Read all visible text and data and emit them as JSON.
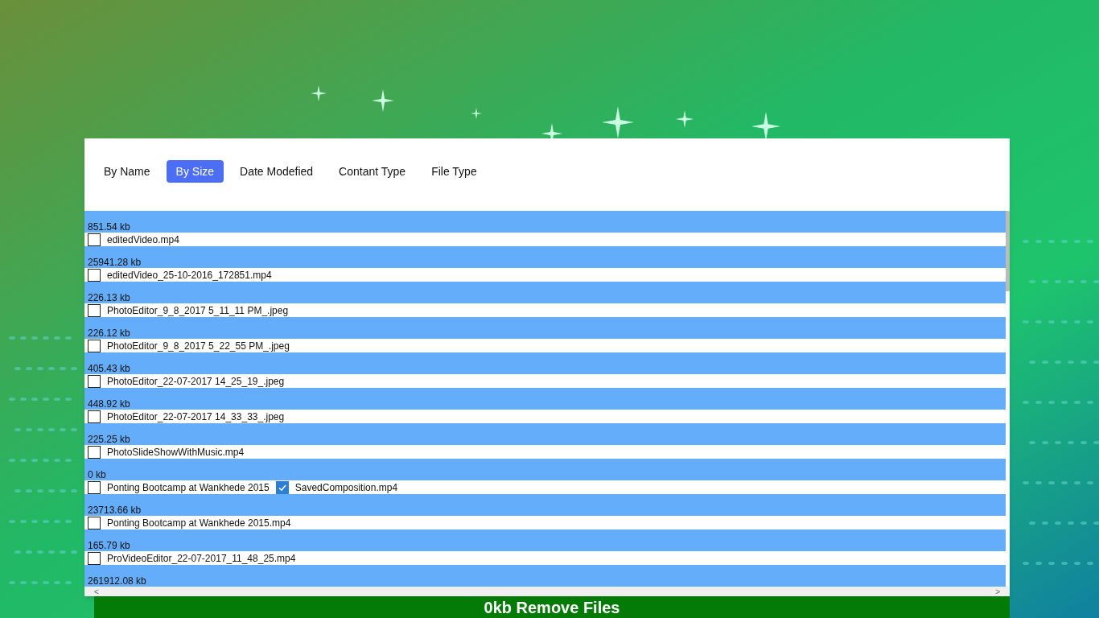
{
  "tabs": [
    {
      "label": "By Name",
      "selected": false
    },
    {
      "label": "By Size",
      "selected": true
    },
    {
      "label": "Date Modefied",
      "selected": false
    },
    {
      "label": "Contant Type",
      "selected": false
    },
    {
      "label": "File Type",
      "selected": false
    }
  ],
  "entries": [
    {
      "size": "851.54 kb",
      "files": [
        {
          "name": "editedVideo.mp4",
          "checked": false
        }
      ]
    },
    {
      "size": "25941.28 kb",
      "files": [
        {
          "name": "editedVideo_25-10-2016_172851.mp4",
          "checked": false
        }
      ]
    },
    {
      "size": "226.13 kb",
      "files": [
        {
          "name": "PhotoEditor_9_8_2017 5_11_11 PM_.jpeg",
          "checked": false
        }
      ]
    },
    {
      "size": "226.12 kb",
      "files": [
        {
          "name": "PhotoEditor_9_8_2017 5_22_55 PM_.jpeg",
          "checked": false
        }
      ]
    },
    {
      "size": "405.43 kb",
      "files": [
        {
          "name": "PhotoEditor_22-07-2017 14_25_19_.jpeg",
          "checked": false
        }
      ]
    },
    {
      "size": "448.92 kb",
      "files": [
        {
          "name": "PhotoEditor_22-07-2017 14_33_33_.jpeg",
          "checked": false
        }
      ]
    },
    {
      "size": "225.25 kb",
      "files": [
        {
          "name": "PhotoSlideShowWithMusic.mp4",
          "checked": false
        }
      ]
    },
    {
      "size": "0 kb",
      "files": [
        {
          "name": "Ponting Bootcamp at Wankhede 2015",
          "checked": false
        },
        {
          "name": "SavedComposition.mp4",
          "checked": true
        }
      ]
    },
    {
      "size": "23713.66 kb",
      "files": [
        {
          "name": "Ponting Bootcamp at Wankhede 2015.mp4",
          "checked": false
        }
      ]
    },
    {
      "size": "165.79 kb",
      "files": [
        {
          "name": "ProVideoEditor_22-07-2017_11_48_25.mp4",
          "checked": false
        }
      ]
    },
    {
      "size": "261912.08 kb"
    }
  ],
  "scroll_left": "<",
  "scroll_right": ">",
  "remove_button": "0kb Remove Files"
}
